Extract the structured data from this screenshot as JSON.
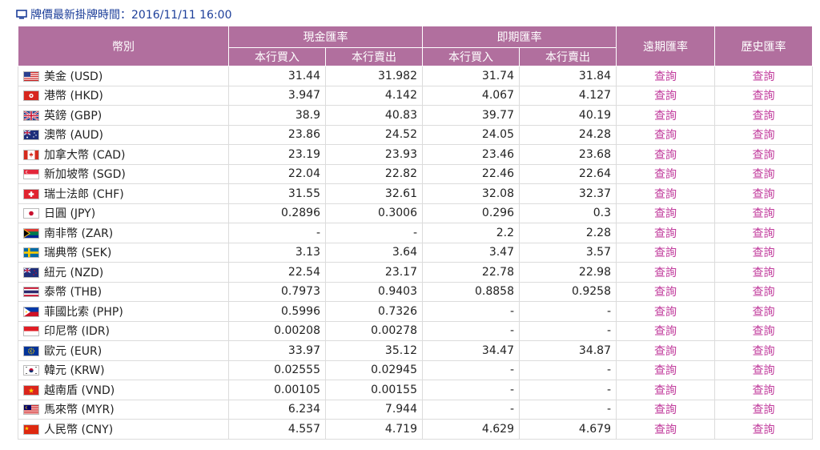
{
  "header": {
    "title": "牌價最新掛牌時間：2016/11/11 16:00",
    "icon": "monitor-icon"
  },
  "table": {
    "col_currency": "幣別",
    "col_cash": "現金匯率",
    "col_spot": "即期匯率",
    "col_forward": "遠期匯率",
    "col_history": "歷史匯率",
    "sub_buy": "本行買入",
    "sub_sell": "本行賣出",
    "link_text": "查詢",
    "header_color": "#b16f9e",
    "link_color": "#c0399b",
    "rows": [
      {
        "flag": "us-flag-icon",
        "name": "美金 (USD)",
        "cash_buy": "31.44",
        "cash_sell": "31.982",
        "spot_buy": "31.74",
        "spot_sell": "31.84"
      },
      {
        "flag": "hk-flag-icon",
        "name": "港幣 (HKD)",
        "cash_buy": "3.947",
        "cash_sell": "4.142",
        "spot_buy": "4.067",
        "spot_sell": "4.127"
      },
      {
        "flag": "gb-flag-icon",
        "name": "英鎊 (GBP)",
        "cash_buy": "38.9",
        "cash_sell": "40.83",
        "spot_buy": "39.77",
        "spot_sell": "40.19"
      },
      {
        "flag": "au-flag-icon",
        "name": "澳幣 (AUD)",
        "cash_buy": "23.86",
        "cash_sell": "24.52",
        "spot_buy": "24.05",
        "spot_sell": "24.28"
      },
      {
        "flag": "ca-flag-icon",
        "name": "加拿大幣 (CAD)",
        "cash_buy": "23.19",
        "cash_sell": "23.93",
        "spot_buy": "23.46",
        "spot_sell": "23.68"
      },
      {
        "flag": "sg-flag-icon",
        "name": "新加坡幣 (SGD)",
        "cash_buy": "22.04",
        "cash_sell": "22.82",
        "spot_buy": "22.46",
        "spot_sell": "22.64"
      },
      {
        "flag": "ch-flag-icon",
        "name": "瑞士法郎 (CHF)",
        "cash_buy": "31.55",
        "cash_sell": "32.61",
        "spot_buy": "32.08",
        "spot_sell": "32.37"
      },
      {
        "flag": "jp-flag-icon",
        "name": "日圓 (JPY)",
        "cash_buy": "0.2896",
        "cash_sell": "0.3006",
        "spot_buy": "0.296",
        "spot_sell": "0.3"
      },
      {
        "flag": "za-flag-icon",
        "name": "南非幣 (ZAR)",
        "cash_buy": "-",
        "cash_sell": "-",
        "spot_buy": "2.2",
        "spot_sell": "2.28"
      },
      {
        "flag": "se-flag-icon",
        "name": "瑞典幣 (SEK)",
        "cash_buy": "3.13",
        "cash_sell": "3.64",
        "spot_buy": "3.47",
        "spot_sell": "3.57"
      },
      {
        "flag": "nz-flag-icon",
        "name": "紐元 (NZD)",
        "cash_buy": "22.54",
        "cash_sell": "23.17",
        "spot_buy": "22.78",
        "spot_sell": "22.98"
      },
      {
        "flag": "th-flag-icon",
        "name": "泰幣 (THB)",
        "cash_buy": "0.7973",
        "cash_sell": "0.9403",
        "spot_buy": "0.8858",
        "spot_sell": "0.9258"
      },
      {
        "flag": "ph-flag-icon",
        "name": "菲國比索 (PHP)",
        "cash_buy": "0.5996",
        "cash_sell": "0.7326",
        "spot_buy": "-",
        "spot_sell": "-"
      },
      {
        "flag": "id-flag-icon",
        "name": "印尼幣 (IDR)",
        "cash_buy": "0.00208",
        "cash_sell": "0.00278",
        "spot_buy": "-",
        "spot_sell": "-"
      },
      {
        "flag": "eu-flag-icon",
        "name": "歐元 (EUR)",
        "cash_buy": "33.97",
        "cash_sell": "35.12",
        "spot_buy": "34.47",
        "spot_sell": "34.87"
      },
      {
        "flag": "kr-flag-icon",
        "name": "韓元 (KRW)",
        "cash_buy": "0.02555",
        "cash_sell": "0.02945",
        "spot_buy": "-",
        "spot_sell": "-"
      },
      {
        "flag": "vn-flag-icon",
        "name": "越南盾 (VND)",
        "cash_buy": "0.00105",
        "cash_sell": "0.00155",
        "spot_buy": "-",
        "spot_sell": "-"
      },
      {
        "flag": "my-flag-icon",
        "name": "馬來幣 (MYR)",
        "cash_buy": "6.234",
        "cash_sell": "7.944",
        "spot_buy": "-",
        "spot_sell": "-"
      },
      {
        "flag": "cn-flag-icon",
        "name": "人民幣 (CNY)",
        "cash_buy": "4.557",
        "cash_sell": "4.719",
        "spot_buy": "4.629",
        "spot_sell": "4.679"
      }
    ]
  }
}
